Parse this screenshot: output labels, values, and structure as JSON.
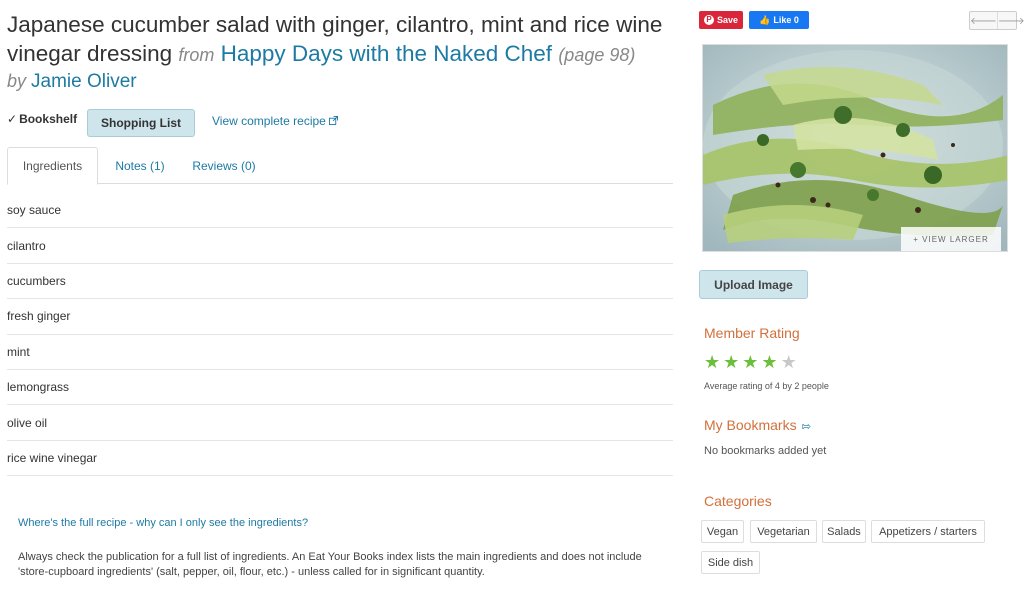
{
  "recipe": {
    "title": "Japanese cucumber salad with ginger, cilantro, mint and rice wine vinegar dressing",
    "from_word": "from",
    "book_title": "Happy Days with the Naked Chef",
    "page_ref": "(page 98)",
    "by_word": "by",
    "author": "Jamie Oliver"
  },
  "actions": {
    "bookshelf_check": "✓",
    "bookshelf_label": "Bookshelf",
    "shopping_list_label": "Shopping List",
    "view_recipe_label": "View complete recipe",
    "view_recipe_icon": "external-link-icon"
  },
  "tabs": [
    {
      "label": "Ingredients"
    },
    {
      "label": "Notes (1)"
    },
    {
      "label": "Reviews (0)"
    }
  ],
  "ingredients": [
    "soy sauce",
    "cilantro",
    "cucumbers",
    "fresh ginger",
    "mint",
    "lemongrass",
    "olive oil",
    "rice wine vinegar"
  ],
  "faq": {
    "question": "Where's the full recipe - why can I only see the ingredients?",
    "answer": "Always check the publication for a full list of ingredients. An Eat Your Books index lists the main ingredients and does not include 'store-cupboard ingredients' (salt, pepper, oil, flour, etc.) - unless called for in significant quantity."
  },
  "social": {
    "save_label": "Save",
    "save_icon": "P",
    "like_label": "Like 0",
    "like_icon": "👍",
    "prev_arrow": "🡐",
    "next_arrow": "🡒"
  },
  "image": {
    "view_larger_label": "+ VIEW LARGER",
    "upload_label": "Upload Image"
  },
  "rating": {
    "heading": "Member Rating",
    "value": 4,
    "max": 5,
    "filled_color": "#6cbf3a",
    "empty_color": "#c8c8c8",
    "summary": "Average rating of 4 by 2 people"
  },
  "bookmarks": {
    "heading": "My Bookmarks",
    "icon": "bookmark-add-icon",
    "empty_text": "No bookmarks added yet"
  },
  "categories": {
    "heading": "Categories",
    "items": [
      "Vegan",
      "Vegetarian",
      "Salads",
      "Appetizers / starters",
      "Side dish"
    ]
  },
  "colors": {
    "link": "#1d7aa3",
    "accent_heading": "#d2703c",
    "pinterest": "#d9263b",
    "facebook": "#1877f2"
  }
}
